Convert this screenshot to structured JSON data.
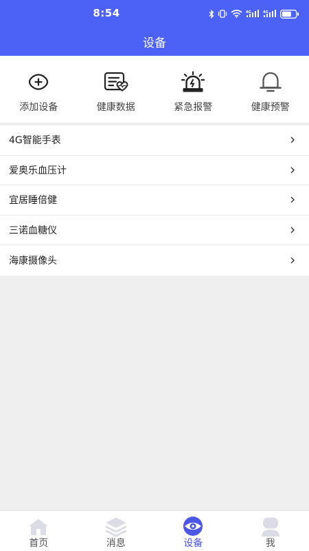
{
  "status_bar": {
    "time": "8:54"
  },
  "header": {
    "title": "设备"
  },
  "quick_actions": [
    {
      "label": "添加设备",
      "icon": "add-circle-icon"
    },
    {
      "label": "健康数据",
      "icon": "health-data-icon"
    },
    {
      "label": "紧急报警",
      "icon": "emergency-siren-icon"
    },
    {
      "label": "健康预警",
      "icon": "bell-icon"
    }
  ],
  "devices": [
    {
      "label": "4G智能手表"
    },
    {
      "label": "爱奥乐血压计"
    },
    {
      "label": "宜居睡倍健"
    },
    {
      "label": "三诺血糖仪"
    },
    {
      "label": "海康摄像头"
    }
  ],
  "tabbar": {
    "items": [
      {
        "label": "首页",
        "icon": "home-icon",
        "active": false
      },
      {
        "label": "消息",
        "icon": "layers-icon",
        "active": false
      },
      {
        "label": "设备",
        "icon": "eye-device-icon",
        "active": true
      },
      {
        "label": "我",
        "icon": "user-icon",
        "active": false
      }
    ]
  },
  "colors": {
    "accent": "#4c62f6",
    "tab_active": "#4c57e6",
    "tab_inactive_icon": "#dcdce6"
  }
}
